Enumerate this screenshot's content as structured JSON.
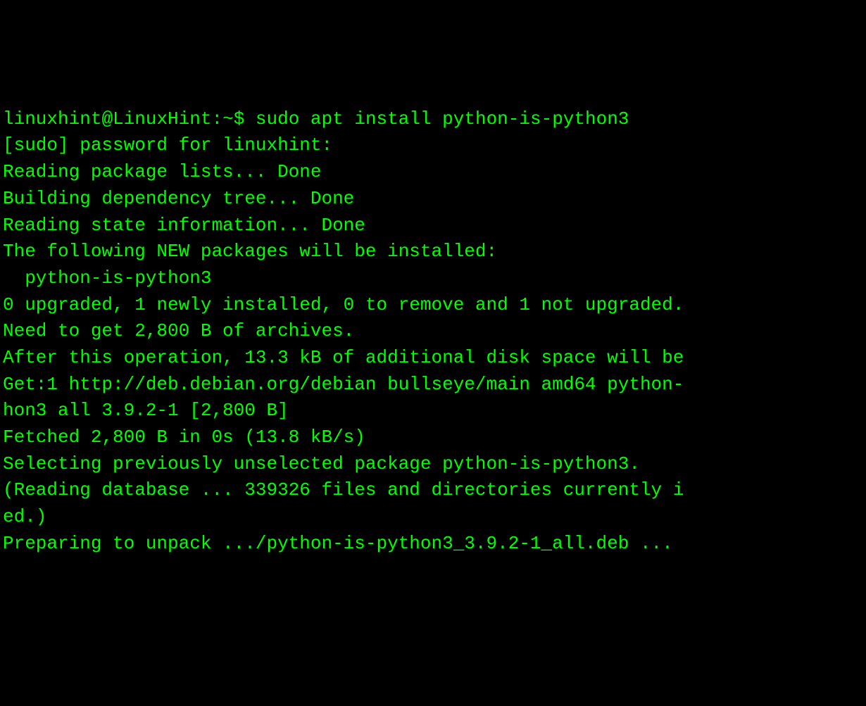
{
  "terminal": {
    "prompt": {
      "user": "linuxhint",
      "separator_at": "@",
      "host": "LinuxHint",
      "colon": ":",
      "path": "~",
      "dollar": "$"
    },
    "command": "sudo apt install python-is-python3",
    "output_lines": [
      "[sudo] password for linuxhint:",
      "Reading package lists... Done",
      "Building dependency tree... Done",
      "Reading state information... Done",
      "The following NEW packages will be installed:",
      "  python-is-python3",
      "0 upgraded, 1 newly installed, 0 to remove and 1 not upgraded.",
      "Need to get 2,800 B of archives.",
      "After this operation, 13.3 kB of additional disk space will be",
      "Get:1 http://deb.debian.org/debian bullseye/main amd64 python-",
      "hon3 all 3.9.2-1 [2,800 B]",
      "Fetched 2,800 B in 0s (13.8 kB/s)",
      "Selecting previously unselected package python-is-python3.",
      "(Reading database ... 339326 files and directories currently i",
      "ed.)",
      "Preparing to unpack .../python-is-python3_3.9.2-1_all.deb ..."
    ]
  }
}
